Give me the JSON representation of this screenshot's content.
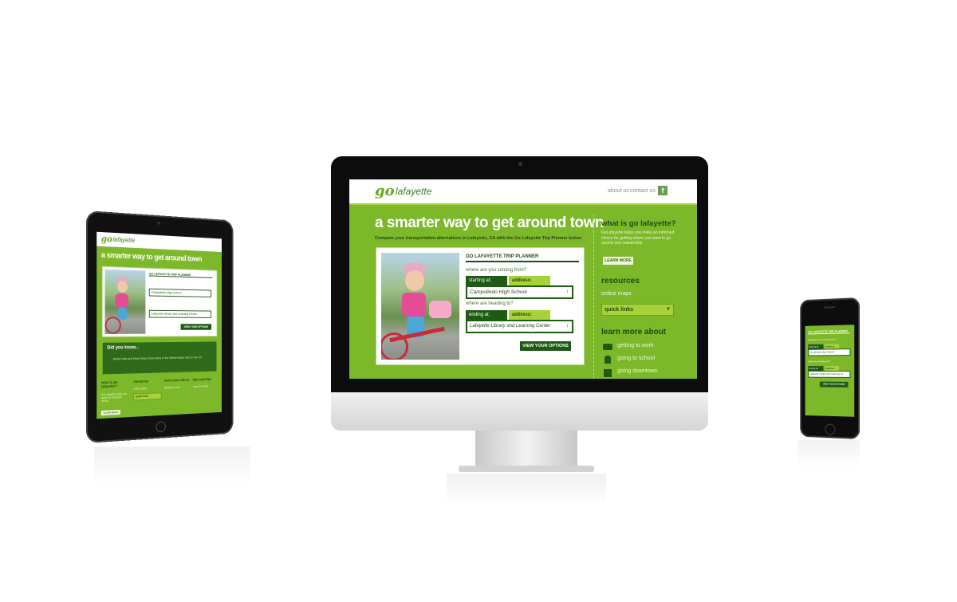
{
  "desktop": {
    "nav": {
      "logo_go": "go",
      "logo_text": "lafayette",
      "about": "about us",
      "contact": "contact us",
      "fb": "f"
    },
    "hero_title": "a smarter way to get around town",
    "subtitle": "Compare your transportation alternatives in Lafayette, CA with the Go Lafayette Trip Planner below",
    "planner": {
      "title": "GO LAFAYETTE  TRIP PLANNER",
      "from_question": "where are you coming from?",
      "starting_label": "starting at:",
      "address_label": "address:",
      "start_value": "Campolindo High School",
      "to_question": "where are heading to?",
      "ending_label": "ending at:",
      "end_address_label": "address:",
      "end_value": "Lafayette Library and Learning Center",
      "button": "VIEW YOUR OPTIONS"
    },
    "sidebar": {
      "what_heading": "what is go lafayette?",
      "what_text": "GoLafayette helps you make an informed choice for getting where you want to go quickly and sustainably.",
      "learn_more": "LEARN MORE",
      "resources_heading": "resources",
      "online_maps": "online maps",
      "quick_links": "quick links",
      "learn_heading": "learn more about",
      "items": [
        "getting to work",
        "going to school",
        "going downtown"
      ]
    }
  },
  "tablet": {
    "logo_go": "go",
    "logo_text": "lafayette",
    "hero_title": "a smarter way to get around town",
    "planner_title": "GO LAFAYETTE  TRIP PLANNER",
    "start_value": "Campolindo High School",
    "end_value": "Lafayette Library and Learning Center",
    "button": "VIEW YOUR OPTIONS",
    "did_you_know": "Did you know...",
    "fact": "Active trips are three times more likely in the Netherlands than in the US",
    "footer_cols": [
      {
        "title": "what is go lafayette?",
        "text": "GoLafayette helps you make an informed choice"
      },
      {
        "title": "resources",
        "text": "online maps"
      },
      {
        "title": "learn more about",
        "text": "getting to work"
      },
      {
        "title": "tips and trips",
        "text": "ideas that work"
      }
    ],
    "quick_links": "quick links",
    "learn_more": "LEARN MORE"
  },
  "phone": {
    "planner_title": "GO LAFAYETTE  TRIP PLANNER",
    "from_question": "where are you coming from?",
    "starting_label": "starting at:",
    "address_label": "address:",
    "start_value": "Campolindo High School",
    "to_question": "where are heading to?",
    "ending_label": "ending at:",
    "end_address_label": "address:",
    "end_value": "Lafayette Library and Learning Ce",
    "button": "VIEW YOUR OPTIONS"
  },
  "colors": {
    "brand_green": "#7cb82a",
    "dark_green": "#1f5a14",
    "lime": "#a7d23a"
  }
}
